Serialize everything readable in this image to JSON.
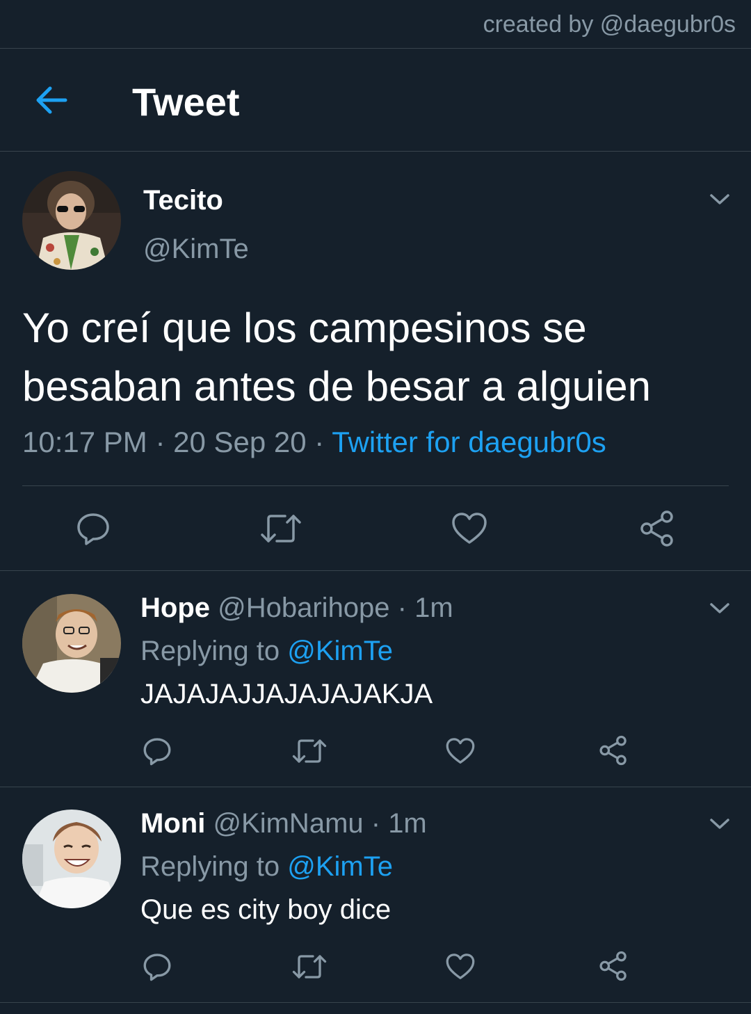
{
  "credit": "created by @daegubr0s",
  "header": {
    "title": "Tweet"
  },
  "tweet": {
    "name": "Tecito",
    "handle": "@KimTe",
    "text": "Yo creí que los campesinos se besaban antes de besar a alguien",
    "time": "10:17 PM",
    "date": "20 Sep 20",
    "sep": " · ",
    "source": "Twitter for daegubr0s"
  },
  "replies": [
    {
      "name": "Hope",
      "handle": "@Hobarihope",
      "age": "1m",
      "replying_prefix": "Replying to ",
      "replying_to": "@KimTe",
      "text": "JAJAJAJJAJAJAJAKJA"
    },
    {
      "name": "Moni",
      "handle": "@KimNamu",
      "age": "1m",
      "replying_prefix": "Replying to ",
      "replying_to": "@KimTe",
      "text": "Que es city boy dice"
    }
  ],
  "colors": {
    "background": "#15202b",
    "accent": "#1da1f2",
    "secondary_text": "#8899a6",
    "divider": "#38444d"
  },
  "icons": [
    "arrow-left",
    "chevron-down",
    "reply",
    "retweet",
    "like",
    "share"
  ]
}
